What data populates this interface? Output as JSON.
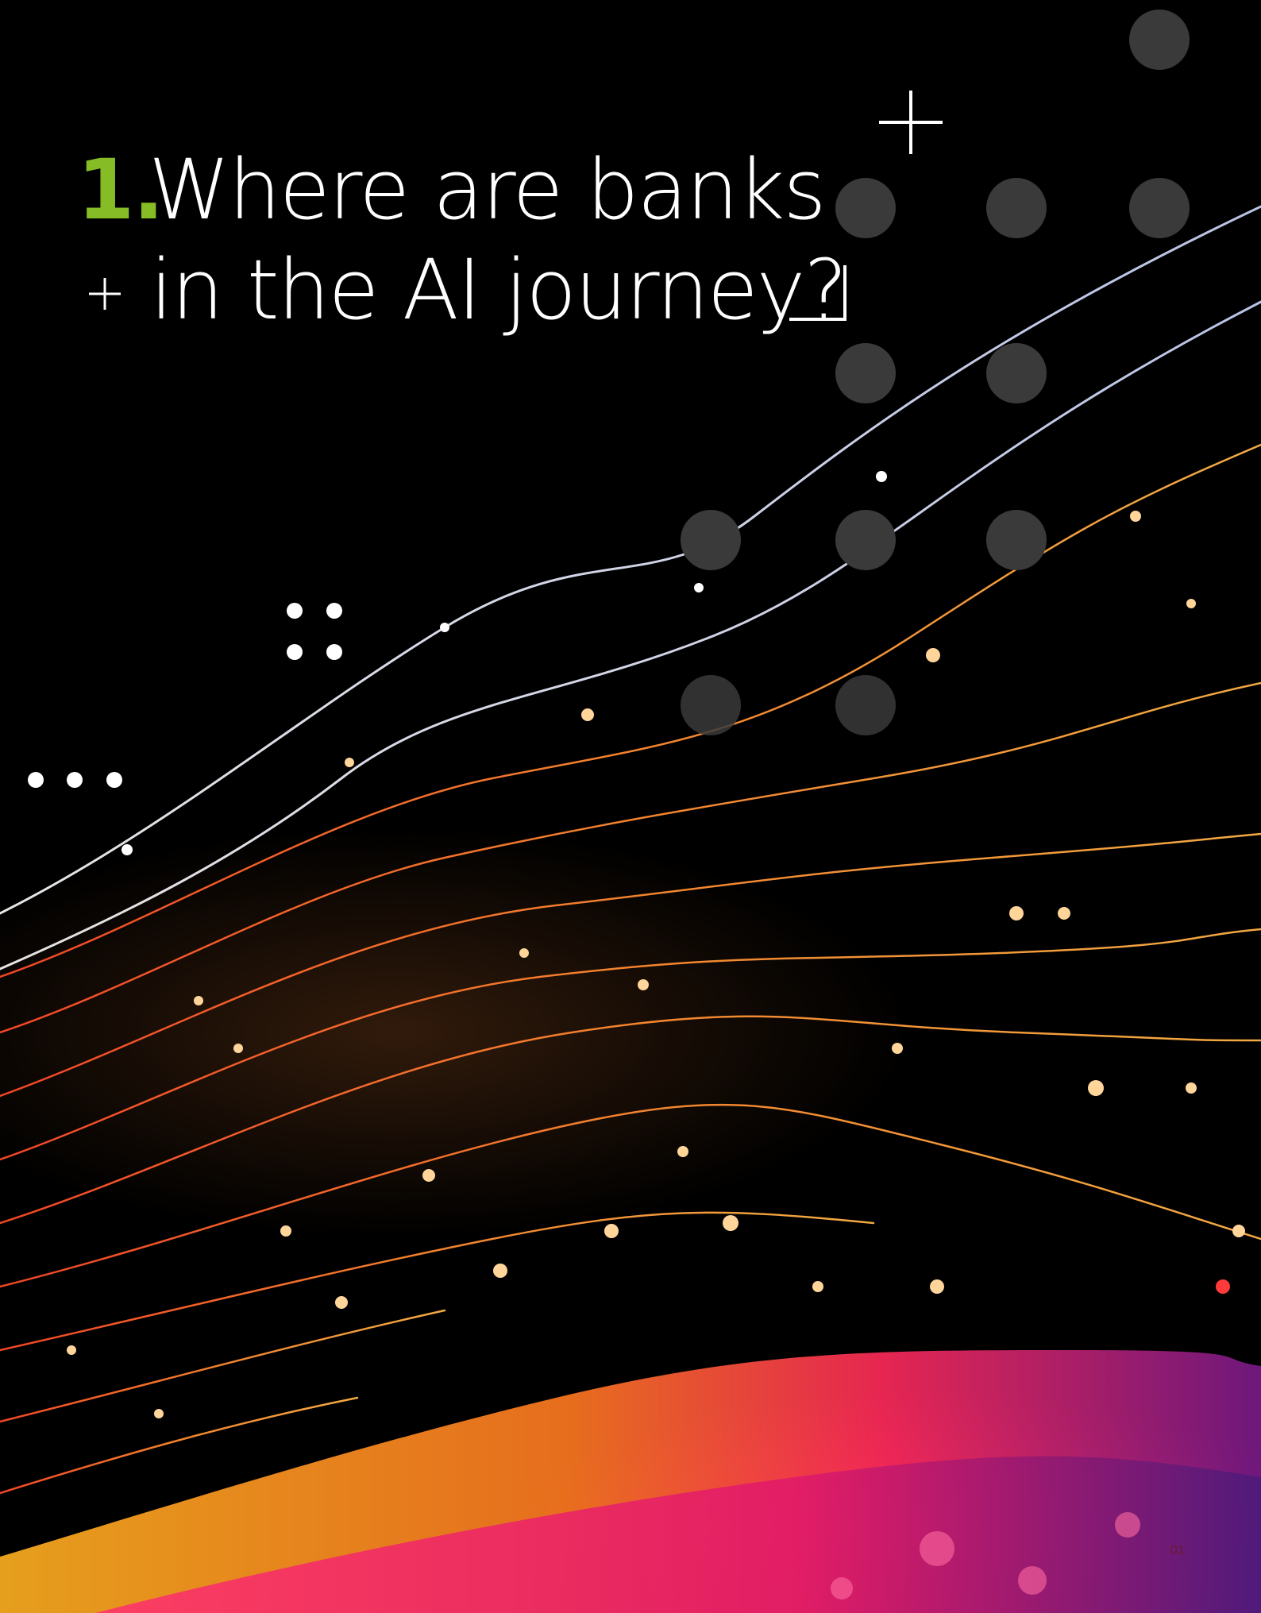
{
  "title": {
    "number": "1.",
    "line1": "Where are banks",
    "line2": "in the AI journey?"
  },
  "page_number": "01",
  "colors": {
    "accent": "#86bc25",
    "background": "#000000",
    "text": "#ffffff",
    "dots": "#3a3a3a"
  },
  "icons": [
    "plus-icon",
    "corner-bracket-icon",
    "four-dots-icon",
    "three-dots-icon"
  ]
}
